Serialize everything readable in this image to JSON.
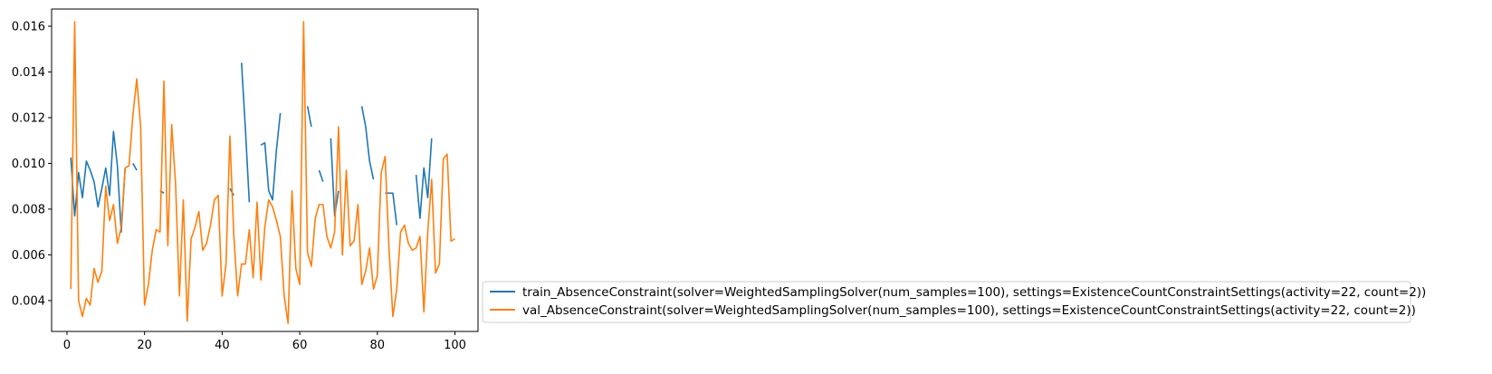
{
  "chart_data": {
    "type": "line",
    "title": "",
    "xlabel": "",
    "ylabel": "",
    "xlim": [
      -3.95,
      105.95
    ],
    "ylim": [
      0.00265,
      0.01675
    ],
    "xticks": [
      0,
      20,
      40,
      60,
      80,
      100
    ],
    "xtick_labels": [
      "0",
      "20",
      "40",
      "60",
      "80",
      "100"
    ],
    "yticks": [
      0.004,
      0.006,
      0.008,
      0.01,
      0.012,
      0.014,
      0.016
    ],
    "ytick_labels": [
      "0.004",
      "0.006",
      "0.008",
      "0.010",
      "0.012",
      "0.014",
      "0.016"
    ],
    "grid": false,
    "legend_position": "outside-lower-right",
    "series": [
      {
        "name": "train_AbsenceConstraint(solver=WeightedSamplingSolver(num_samples=100), settings=ExistenceCountConstraintSettings(activity=22, count=2))",
        "color": "#1f77b4",
        "x": [
          1,
          2,
          3,
          4,
          5,
          6,
          7,
          8,
          9,
          10,
          11,
          12,
          13,
          14,
          15,
          16,
          17,
          18,
          19,
          20,
          21,
          22,
          23,
          24,
          25,
          26,
          27,
          28,
          29,
          30,
          31,
          32,
          33,
          34,
          35,
          36,
          37,
          38,
          39,
          40,
          41,
          42,
          43,
          44,
          45,
          46,
          47,
          48,
          49,
          50,
          51,
          52,
          53,
          54,
          55,
          56,
          57,
          58,
          59,
          60,
          61,
          62,
          63,
          64,
          65,
          66,
          67,
          68,
          69,
          70,
          71,
          72,
          73,
          74,
          75,
          76,
          77,
          78,
          79,
          80,
          81,
          82,
          83,
          84,
          85,
          86,
          87,
          88,
          89,
          90,
          91,
          92,
          93,
          94,
          95,
          96,
          97,
          98,
          99,
          100
        ],
        "y": [
          0.01025,
          0.0077,
          0.0096,
          0.0085,
          0.0101,
          0.0097,
          0.0092,
          0.0081,
          0.0089,
          0.0098,
          0.0086,
          0.0114,
          0.0099,
          0.007,
          0.0098,
          null,
          0.01,
          0.0097,
          null,
          null,
          null,
          null,
          null,
          0.0088,
          0.0087,
          null,
          null,
          null,
          null,
          null,
          null,
          null,
          null,
          null,
          null,
          null,
          null,
          null,
          null,
          null,
          null,
          0.0089,
          0.0086,
          null,
          0.0144,
          0.0115,
          0.0083,
          null,
          null,
          0.0108,
          0.0109,
          0.0088,
          0.0084,
          0.0106,
          0.0122,
          null,
          null,
          null,
          null,
          null,
          null,
          0.0125,
          0.0116,
          null,
          0.0097,
          0.0092,
          null,
          0.0111,
          0.0077,
          0.0088,
          null,
          null,
          null,
          null,
          null,
          0.0125,
          0.0116,
          0.0101,
          0.0093,
          null,
          null,
          0.0087,
          0.0087,
          0.0087,
          0.0073,
          null,
          null,
          null,
          null,
          0.0095,
          0.0076,
          0.0098,
          0.0085,
          0.0111,
          null,
          null,
          null,
          null,
          null,
          null
        ]
      },
      {
        "name": "val_AbsenceConstraint(solver=WeightedSamplingSolver(num_samples=100), settings=ExistenceCountConstraintSettings(activity=22, count=2))",
        "color": "#ff7f0e",
        "x": [
          1,
          2,
          3,
          4,
          5,
          6,
          7,
          8,
          9,
          10,
          11,
          12,
          13,
          14,
          15,
          16,
          17,
          18,
          19,
          20,
          21,
          22,
          23,
          24,
          25,
          26,
          27,
          28,
          29,
          30,
          31,
          32,
          33,
          34,
          35,
          36,
          37,
          38,
          39,
          40,
          41,
          42,
          43,
          44,
          45,
          46,
          47,
          48,
          49,
          50,
          51,
          52,
          53,
          54,
          55,
          56,
          57,
          58,
          59,
          60,
          61,
          62,
          63,
          64,
          65,
          66,
          67,
          68,
          69,
          70,
          71,
          72,
          73,
          74,
          75,
          76,
          77,
          78,
          79,
          80,
          81,
          82,
          83,
          84,
          85,
          86,
          87,
          88,
          89,
          90,
          91,
          92,
          93,
          94,
          95,
          96,
          97,
          98,
          99,
          100
        ],
        "y": [
          0.0045,
          0.0162,
          0.004,
          0.0033,
          0.0041,
          0.0038,
          0.0054,
          0.0048,
          0.0053,
          0.009,
          0.0075,
          0.0082,
          0.0065,
          0.0072,
          0.0098,
          0.0099,
          0.0121,
          0.0137,
          0.0116,
          0.0038,
          0.0047,
          0.0062,
          0.0071,
          0.007,
          0.0136,
          0.0064,
          0.0117,
          0.0091,
          0.0042,
          0.0084,
          0.0031,
          0.0067,
          0.0072,
          0.0079,
          0.0062,
          0.0065,
          0.0073,
          0.0084,
          0.0086,
          0.0042,
          0.0056,
          0.0112,
          0.0069,
          0.0042,
          0.0056,
          0.0056,
          0.0071,
          0.005,
          0.0083,
          0.0049,
          0.0072,
          0.0084,
          0.0081,
          0.0075,
          0.0068,
          0.0042,
          0.003,
          0.0088,
          0.0054,
          0.0047,
          0.0162,
          0.0061,
          0.0055,
          0.0076,
          0.0082,
          0.0082,
          0.0068,
          0.0063,
          0.007,
          0.0116,
          0.006,
          0.0097,
          0.0064,
          0.0066,
          0.0082,
          0.0047,
          0.0053,
          0.0063,
          0.0045,
          0.0051,
          0.0096,
          0.0103,
          0.0063,
          0.0033,
          0.0045,
          0.007,
          0.0073,
          0.0065,
          0.0062,
          0.0063,
          0.0068,
          0.0035,
          0.007,
          0.0093,
          0.0052,
          0.0056,
          0.0102,
          0.0104,
          0.0066,
          0.0067
        ]
      }
    ]
  }
}
